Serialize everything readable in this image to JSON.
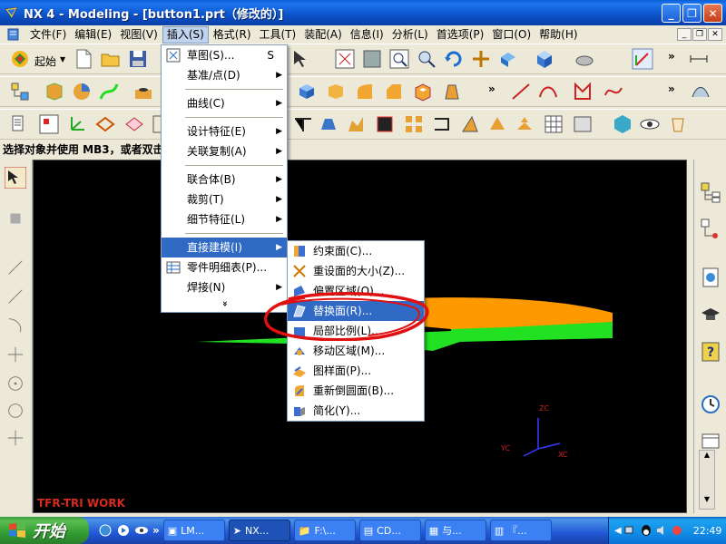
{
  "window": {
    "title": "NX 4 - Modeling - [button1.prt（修改的）]",
    "controls": [
      "minimize-icon",
      "maximize-icon",
      "close-icon"
    ]
  },
  "menubar": {
    "items": [
      {
        "label": "文件(F)"
      },
      {
        "label": "编辑(E)"
      },
      {
        "label": "视图(V)"
      },
      {
        "label": "插入(S)",
        "active": true
      },
      {
        "label": "格式(R)"
      },
      {
        "label": "工具(T)"
      },
      {
        "label": "装配(A)"
      },
      {
        "label": "信息(I)"
      },
      {
        "label": "分析(L)"
      },
      {
        "label": "首选项(P)"
      },
      {
        "label": "窗口(O)"
      },
      {
        "label": "帮助(H)"
      }
    ]
  },
  "toolbar": {
    "start_label": "起始",
    "chevron": "»"
  },
  "prompt_text": "选择对象并使用 MB3，或者双击",
  "insert_menu": {
    "items": [
      {
        "label": "草图(S)...",
        "accel": "S",
        "icon": "sketch-icon",
        "submenu": false
      },
      {
        "label": "基准/点(D)",
        "submenu": true
      },
      {
        "sep": true
      },
      {
        "label": "曲线(C)",
        "submenu": true
      },
      {
        "sep": true
      },
      {
        "label": "设计特征(E)",
        "submenu": true
      },
      {
        "label": "关联复制(A)",
        "submenu": true
      },
      {
        "sep": true
      },
      {
        "label": "联合体(B)",
        "submenu": true
      },
      {
        "label": "裁剪(T)",
        "submenu": true
      },
      {
        "label": "细节特征(L)",
        "submenu": true
      },
      {
        "sep": true
      },
      {
        "label": "直接建模(I)",
        "submenu": true,
        "highlighted": true
      },
      {
        "label": "零件明细表(P)...",
        "icon": "parts-list-icon",
        "submenu": false
      },
      {
        "label": "焊接(N)",
        "submenu": true
      }
    ],
    "more": "»"
  },
  "direct_modeling_submenu": {
    "items": [
      {
        "label": "约束面(C)...",
        "icon": "constrain-face-icon"
      },
      {
        "label": "重设面的大小(Z)...",
        "icon": "resize-face-icon"
      },
      {
        "label": "偏置区域(O)...",
        "icon": "offset-region-icon"
      },
      {
        "label": "替换面(R)...",
        "icon": "replace-face-icon",
        "highlighted": true
      },
      {
        "label": "局部比例(L)...",
        "icon": "local-scale-icon"
      },
      {
        "label": "移动区域(M)...",
        "icon": "move-region-icon"
      },
      {
        "label": "图样面(P)...",
        "icon": "pattern-face-icon"
      },
      {
        "label": "重新倒圆面(B)...",
        "icon": "reblend-face-icon"
      },
      {
        "label": "简化(Y)...",
        "icon": "simplify-icon"
      }
    ]
  },
  "viewport": {
    "watermark": "TFR-TRI WORK",
    "axes": {
      "z": "ZC",
      "y": "YC",
      "x": "XC"
    },
    "colors": {
      "background": "#000000",
      "top_body": "#ff9900",
      "bottom_body": "#22e022"
    }
  },
  "taskbar": {
    "start_label": "开始",
    "tasks": [
      {
        "label": "LM..."
      },
      {
        "label": "NX...",
        "active": true
      },
      {
        "label": "F:\\..."
      },
      {
        "label": "CD..."
      },
      {
        "label": "与..."
      },
      {
        "label": "『..."
      }
    ],
    "clock": "22:49"
  },
  "colors": {
    "menu_highlight": "#316ac5",
    "annotation": "#e01010"
  }
}
